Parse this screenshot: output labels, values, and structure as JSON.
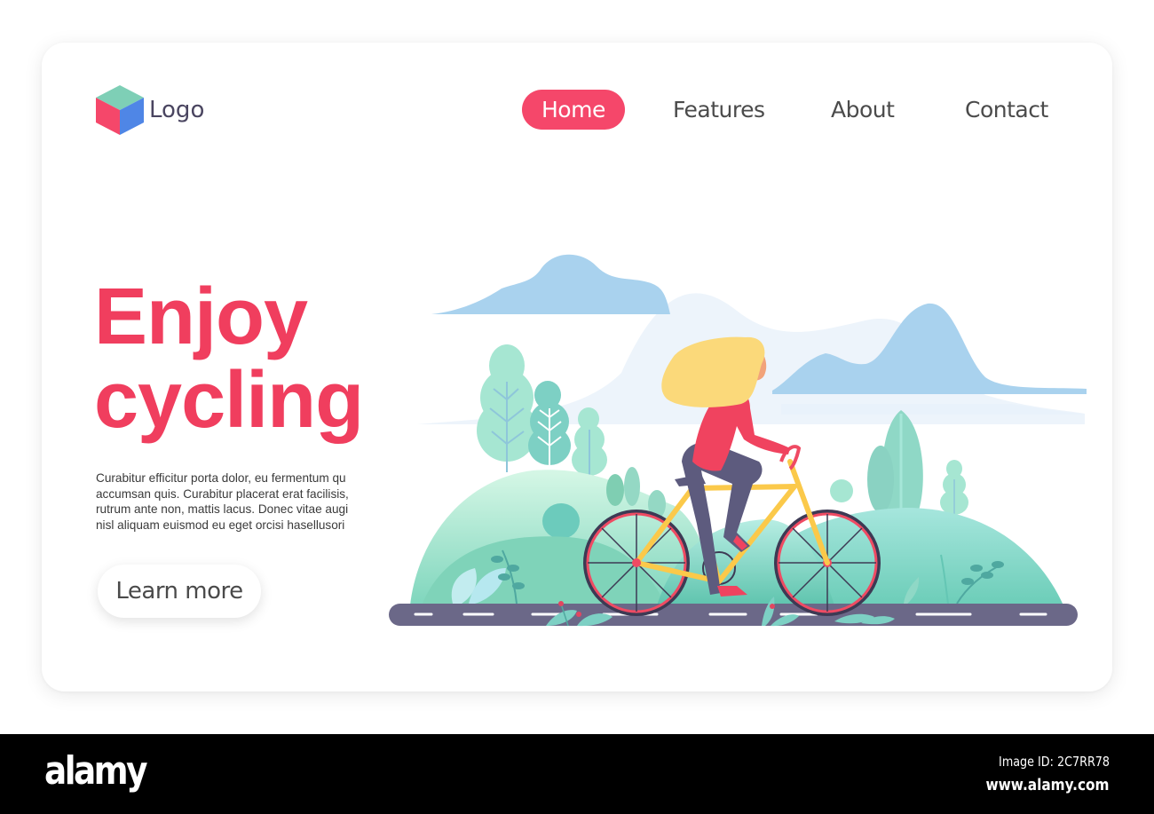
{
  "header": {
    "logo_label": "Logo",
    "logo_colors": {
      "top": "#7ecfb6",
      "left": "#f5476a",
      "right": "#4f86e6"
    }
  },
  "nav": {
    "items": [
      {
        "label": "Home",
        "active": true
      },
      {
        "label": "Features",
        "active": false
      },
      {
        "label": "About",
        "active": false
      },
      {
        "label": "Contact",
        "active": false
      }
    ],
    "accent": "#f5476a"
  },
  "hero": {
    "title_line1": "Enjoy",
    "title_line2": "cycling",
    "description_lines": [
      "Curabitur efficitur porta dolor, eu fermentum qu",
      "accumsan quis. Curabitur placerat erat facilisis,",
      "rutrum ante non, mattis lacus. Donec vitae augi",
      "nisl aliquam euismod eu eget orcisi  hasellusori"
    ],
    "cta_label": "Learn more",
    "title_color": "#f03e5e"
  },
  "illustration": {
    "subject": "woman-riding-bicycle",
    "colors": {
      "cloud": "#a9d2ee",
      "mist": "#eaf2fb",
      "hill": "#8fdcc8",
      "road": "#6b6888",
      "bike_frame": "#fbc94a",
      "wheel_rim": "#ef4b63",
      "hair": "#fbd97a",
      "shirt": "#f0435f",
      "pants": "#5d5b7e"
    }
  },
  "watermark": {
    "brand": "alamy",
    "image_id": "Image ID: 2C7RR78",
    "site": "www.alamy.com"
  }
}
